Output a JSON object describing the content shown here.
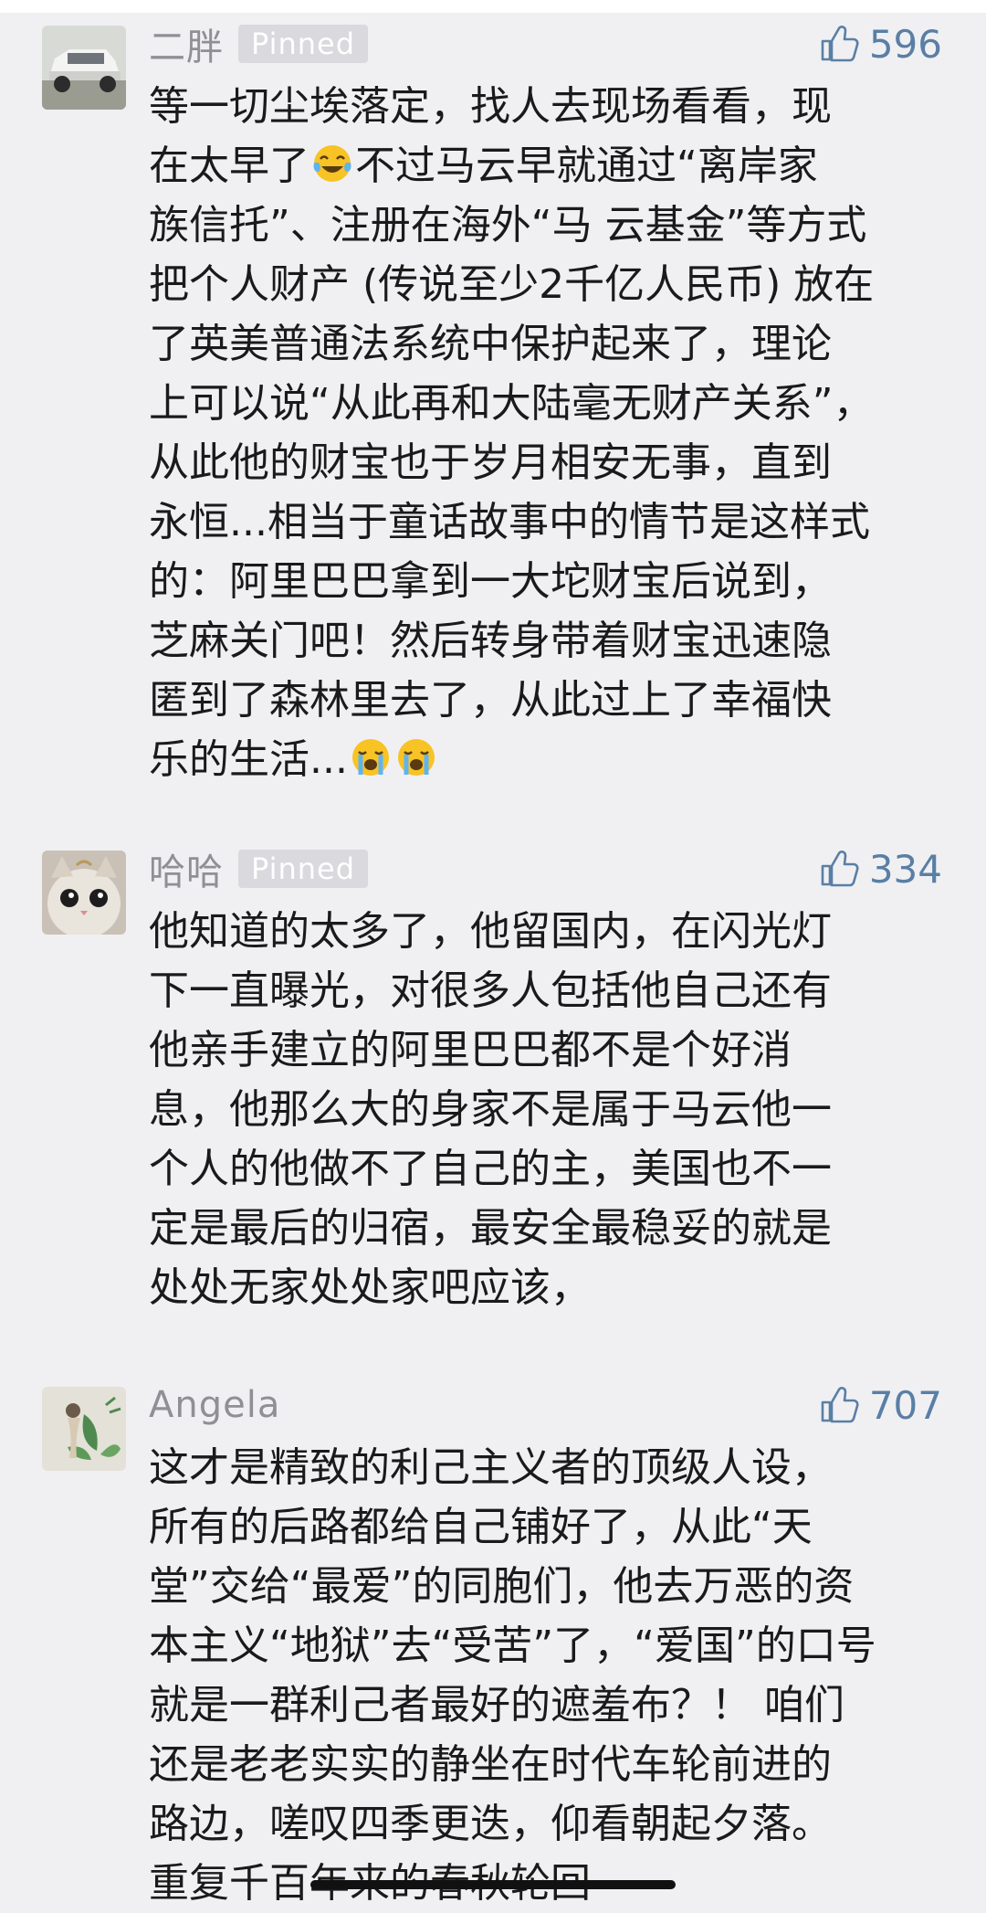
{
  "comments": [
    {
      "username": "二胖",
      "pinned_label": "Pinned",
      "likes": "596",
      "lines": [
        "等一切尘埃落定，找人去现场看看，现",
        "在太早了",
        "不过马云早就通过“离岸家",
        "族信托”、注册在海外“马 云基金”等方式",
        "把个人财产 (传说至少2千亿人民币) 放在",
        "了英美普通法系统中保护起来了，理论",
        "上可以说“从此再和大陆毫无财产关系”，",
        "从此他的财宝也于岁月相安无事，直到",
        "永恒...相当于童话故事中的情节是这样式",
        "的：阿里巴巴拿到一大坨财宝后说到，",
        "芝麻关门吧！然后转身带着财宝迅速隐",
        "匿到了森林里去了，从此过上了幸福快",
        "乐的生活..."
      ]
    },
    {
      "username": "哈哈",
      "pinned_label": "Pinned",
      "likes": "334",
      "lines": [
        "他知道的太多了，他留国内，在闪光灯",
        "下一直曝光，对很多人包括他自己还有",
        "他亲手建立的阿里巴巴都不是个好消",
        "息，他那么大的身家不是属于马云他一",
        "个人的他做不了自己的主，美国也不一",
        "定是最后的归宿，最安全最稳妥的就是",
        "处处无家处处家吧应该，"
      ]
    },
    {
      "username": "Angela",
      "likes": "707",
      "lines": [
        "这才是精致的利己主义者的顶级人设，",
        "所有的后路都给自己铺好了，从此“天",
        "堂”交给“最爱”的同胞们，他去万恶的资",
        "本主义“地狱”去“受苦”了，“爱国”的口号",
        "就是一群利己者最好的遮羞布？！ 咱们",
        "还是老老实实的静坐在时代车轮前进的",
        "路边，嗟叹四季更迭，仰看朝起夕落。",
        "重复千百年来的春秋轮回~"
      ]
    }
  ],
  "icons": {
    "like": "thumbs-up-icon",
    "emoji_laugh": "tears-of-joy-emoji",
    "emoji_cry": "loudly-crying-emoji"
  },
  "colors": {
    "background": "#f0f0f3",
    "username": "#8f8f95",
    "pinned_badge": "#d9d9de",
    "like_accent": "#5a7fa5"
  }
}
